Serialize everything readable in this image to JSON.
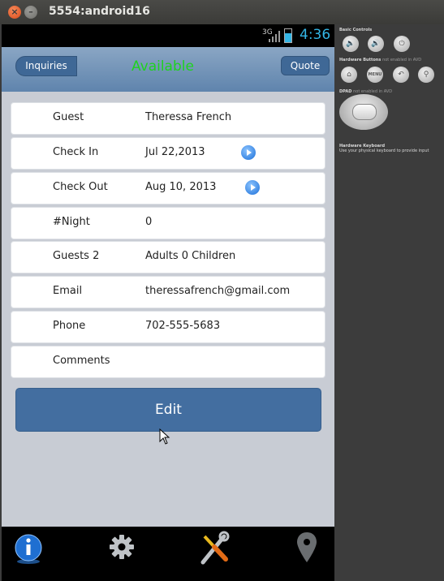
{
  "window": {
    "title": "5554:android16",
    "close_glyph": "×",
    "minimize_glyph": "–"
  },
  "status_bar": {
    "network": "3G",
    "time": "4:36"
  },
  "header": {
    "left_button": "Inquiries",
    "title": "Available",
    "right_button": "Quote"
  },
  "form": {
    "rows": [
      {
        "label": "Guest",
        "value": "Theressa French"
      },
      {
        "label": "Check In",
        "value": "Jul 22,2013"
      },
      {
        "label": "Check Out",
        "value": "Aug 10, 2013"
      },
      {
        "label": "#Night",
        "value": "0"
      },
      {
        "label": "Guests  2",
        "value": "Adults  0  Children"
      },
      {
        "label": "Email",
        "value": "theressafrench@gmail.com"
      },
      {
        "label": "Phone",
        "value": "702-555-5683"
      },
      {
        "label": "Comments",
        "value": ""
      }
    ],
    "edit_button": "Edit"
  },
  "tabs": [
    {
      "icon": "info-icon"
    },
    {
      "icon": "gear-icon"
    },
    {
      "icon": "tools-icon"
    },
    {
      "icon": "location-pin-icon"
    }
  ],
  "emulator_panel": {
    "basic_controls_title": "Basic Controls",
    "hardware_buttons_title": "Hardware Buttons",
    "hardware_buttons_note": "not enabled in AVD",
    "menu_label": "MENU",
    "dpad_title": "DPAD",
    "dpad_note": "not enabled in AVD",
    "keyboard_title": "Hardware Keyboard",
    "keyboard_note": "Use your physical keyboard to provide input"
  },
  "colors": {
    "accent_blue": "#436ea0",
    "status_green": "#1ed31e",
    "clock_blue": "#33b5e5"
  }
}
